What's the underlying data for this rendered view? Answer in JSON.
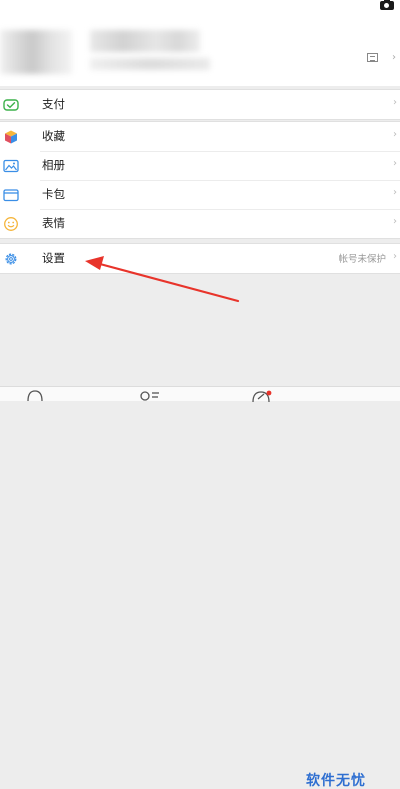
{
  "header": {
    "avatar_icon": "avatar-icon",
    "qr_icon": "qr-code-icon",
    "camera_icon": "camera-icon",
    "chevron": "›"
  },
  "menu_groups": [
    {
      "items": [
        {
          "label": "支付",
          "icon": "payment-icon",
          "color": "#3bb14a"
        }
      ]
    },
    {
      "items": [
        {
          "label": "收藏",
          "icon": "favorites-cube-icon",
          "color": "#e04f5f"
        },
        {
          "label": "相册",
          "icon": "album-icon",
          "color": "#3a8ee6"
        },
        {
          "label": "卡包",
          "icon": "card-wallet-icon",
          "color": "#3a8ee6"
        },
        {
          "label": "表情",
          "icon": "emoji-icon",
          "color": "#f5b53b"
        }
      ]
    },
    {
      "items": [
        {
          "label": "设置",
          "icon": "settings-gear-icon",
          "color": "#3a8ee6",
          "extra": "帐号未保护"
        }
      ]
    }
  ],
  "annotation": {
    "type": "red-arrow",
    "color": "#e8342b",
    "points_to": "设置"
  },
  "tabbar": {
    "icons": [
      "chats-icon",
      "contacts-icon",
      "discover-icon"
    ],
    "watermark": "软件无忧"
  }
}
